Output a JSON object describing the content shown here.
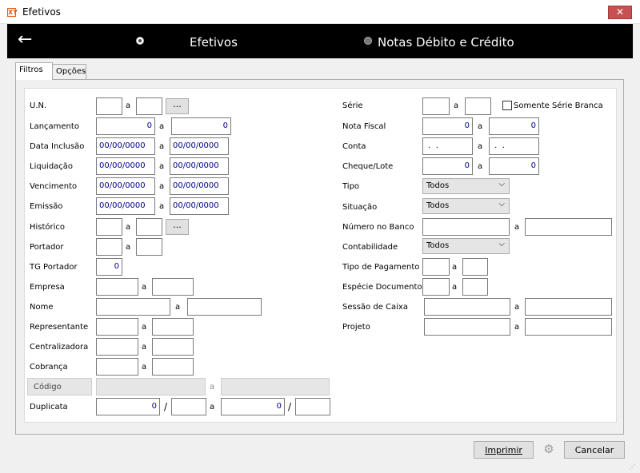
{
  "window": {
    "title": "Efetivos",
    "close_label": "✕",
    "app_icon": "XY"
  },
  "header": {
    "back_icon": "←",
    "options": [
      {
        "label": "Efetivos",
        "selected": true
      },
      {
        "label": "Notas Débito e Crédito",
        "selected": false
      }
    ]
  },
  "tabs": [
    {
      "label": "Filtros",
      "active": true
    },
    {
      "label": "Opções",
      "active": false
    }
  ],
  "separator": "a",
  "slash": "/",
  "dots_label": "...",
  "left": {
    "un": {
      "label": "U.N.",
      "from": "",
      "to": ""
    },
    "lancamento": {
      "label": "Lançamento",
      "from": "0",
      "to": "0"
    },
    "data_inclusao": {
      "label": "Data Inclusão",
      "from": "00/00/0000",
      "to": "00/00/0000"
    },
    "liquidacao": {
      "label": "Liquidação",
      "from": "00/00/0000",
      "to": "00/00/0000"
    },
    "vencimento": {
      "label": "Vencimento",
      "from": "00/00/0000",
      "to": "00/00/0000"
    },
    "emissao": {
      "label": "Emissão",
      "from": "00/00/0000",
      "to": "00/00/0000"
    },
    "historico": {
      "label": "Histórico",
      "from": "",
      "to": ""
    },
    "portador": {
      "label": "Portador",
      "from": "",
      "to": ""
    },
    "tg_portador": {
      "label": "TG Portador",
      "value": "0"
    },
    "empresa": {
      "label": "Empresa",
      "from": "",
      "to": ""
    },
    "nome": {
      "label": "Nome",
      "from": "",
      "to": ""
    },
    "representante": {
      "label": "Representante",
      "from": "",
      "to": ""
    },
    "centralizadora": {
      "label": "Centralizadora",
      "from": "",
      "to": ""
    },
    "cobranca": {
      "label": "Cobrança",
      "from": "",
      "to": ""
    },
    "codigo": {
      "label": "Código",
      "from": "",
      "to": ""
    },
    "duplicata": {
      "label": "Duplicata",
      "from_num": "0",
      "from_parc": "",
      "to_num": "0",
      "to_parc": ""
    }
  },
  "right": {
    "serie": {
      "label": "Série",
      "from": "",
      "to": ""
    },
    "somente_serie_branca": {
      "label": "Somente Série Branca",
      "checked": false
    },
    "nota_fiscal": {
      "label": "Nota Fiscal",
      "from": "0",
      "to": "0"
    },
    "conta": {
      "label": "Conta",
      "from": " .  .",
      "to": " .  ."
    },
    "cheque_lote": {
      "label": "Cheque/Lote",
      "from": "0",
      "to": "0"
    },
    "tipo": {
      "label": "Tipo",
      "value": "Todos"
    },
    "situacao": {
      "label": "Situação",
      "value": "Todos"
    },
    "numero_banco": {
      "label": "Número no Banco",
      "from": "",
      "to": ""
    },
    "contabilidade": {
      "label": "Contabilidade",
      "value": "Todos"
    },
    "tipo_pagamento": {
      "label": "Tipo de Pagamento",
      "from": "",
      "to": ""
    },
    "especie_documento": {
      "label": "Espécie Documento",
      "from": "",
      "to": ""
    },
    "sessao_caixa": {
      "label": "Sessão de Caixa",
      "from": "",
      "to": ""
    },
    "projeto": {
      "label": "Projeto",
      "from": "",
      "to": ""
    }
  },
  "footer": {
    "print_label": "Imprimir",
    "cancel_label": "Cancelar",
    "gear_icon": "⚙"
  },
  "icons": {
    "dropdown": "⌵",
    "grip": "⋰"
  },
  "colors": {
    "header_bg": "#000000",
    "close_button": "#c75050",
    "numeric_text": "#00008b"
  }
}
